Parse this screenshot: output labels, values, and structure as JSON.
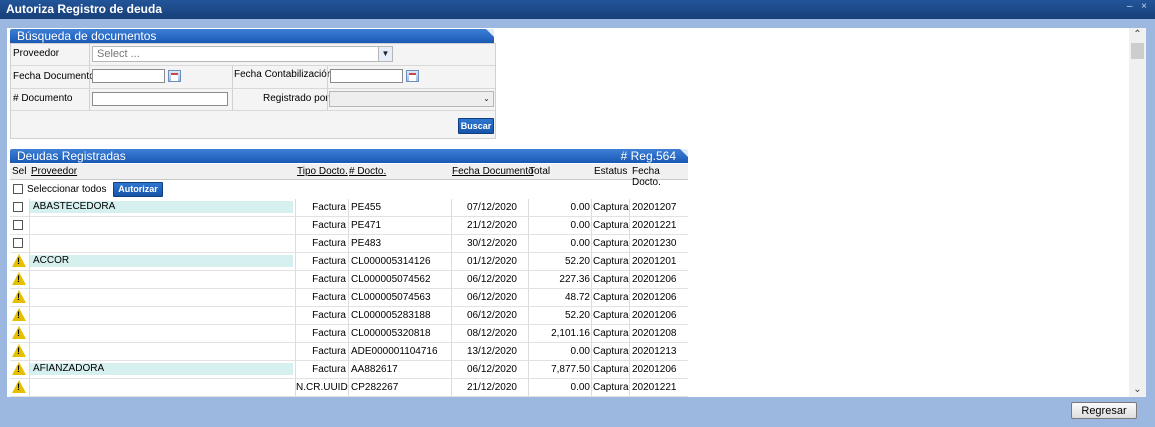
{
  "window": {
    "title": "Autoriza Registro de deuda",
    "minimize": "–",
    "close": "×"
  },
  "search": {
    "header": "Búsqueda de documentos",
    "proveedor_label": "Proveedor",
    "proveedor_placeholder": "Select ...",
    "fecha_documento_label": "Fecha Documento",
    "fecha_contabilizacion_label": "Fecha Contabilización",
    "num_documento_label": "# Documento",
    "registrado_por_label": "Registrado por",
    "buscar_label": "Buscar"
  },
  "grid": {
    "header": "Deudas Registradas",
    "reg_count": "# Reg.564",
    "columns": {
      "sel": "Sel",
      "proveedor": "Proveedor",
      "tipo": "Tipo Docto.",
      "num": "# Docto.",
      "fecha": "Fecha Documento",
      "total": "Total",
      "estatus": "Estatus",
      "fecha2": "Fecha Docto."
    },
    "select_all_label": "Seleccionar todos",
    "autorizar_label": "Autorizar",
    "rows": [
      {
        "icon": "checkbox",
        "proveedor": "ABASTECEDORA",
        "tipo": "Factura",
        "num": "PE455",
        "fecha": "07/12/2020",
        "total": "0.00",
        "estatus": "Captura",
        "fecha2": "20201207"
      },
      {
        "icon": "checkbox",
        "proveedor": "",
        "tipo": "Factura",
        "num": "PE471",
        "fecha": "21/12/2020",
        "total": "0.00",
        "estatus": "Captura",
        "fecha2": "20201221"
      },
      {
        "icon": "checkbox",
        "proveedor": "",
        "tipo": "Factura",
        "num": "PE483",
        "fecha": "30/12/2020",
        "total": "0.00",
        "estatus": "Captura",
        "fecha2": "20201230"
      },
      {
        "icon": "warning",
        "proveedor": "ACCOR",
        "tipo": "Factura",
        "num": "CL000005314126",
        "fecha": "01/12/2020",
        "total": "52.20",
        "estatus": "Captura",
        "fecha2": "20201201"
      },
      {
        "icon": "warning",
        "proveedor": "",
        "tipo": "Factura",
        "num": "CL000005074562",
        "fecha": "06/12/2020",
        "total": "227.36",
        "estatus": "Captura",
        "fecha2": "20201206"
      },
      {
        "icon": "warning",
        "proveedor": "",
        "tipo": "Factura",
        "num": "CL000005074563",
        "fecha": "06/12/2020",
        "total": "48.72",
        "estatus": "Captura",
        "fecha2": "20201206"
      },
      {
        "icon": "warning",
        "proveedor": "",
        "tipo": "Factura",
        "num": "CL000005283188",
        "fecha": "06/12/2020",
        "total": "52.20",
        "estatus": "Captura",
        "fecha2": "20201206"
      },
      {
        "icon": "warning",
        "proveedor": "",
        "tipo": "Factura",
        "num": "CL000005320818",
        "fecha": "08/12/2020",
        "total": "2,101.16",
        "estatus": "Captura",
        "fecha2": "20201208"
      },
      {
        "icon": "warning",
        "proveedor": "",
        "tipo": "Factura",
        "num": "ADE000001104716",
        "fecha": "13/12/2020",
        "total": "0.00",
        "estatus": "Captura",
        "fecha2": "20201213"
      },
      {
        "icon": "warning",
        "proveedor": "AFIANZADORA",
        "tipo": "Factura",
        "num": "AA882617",
        "fecha": "06/12/2020",
        "total": "7,877.50",
        "estatus": "Captura",
        "fecha2": "20201206"
      },
      {
        "icon": "warning",
        "proveedor": "",
        "tipo": "N.CR.UUID",
        "num": "CP282267",
        "fecha": "21/12/2020",
        "total": "0.00",
        "estatus": "Captura",
        "fecha2": "20201221"
      }
    ]
  },
  "footer": {
    "regresar_label": "Regresar"
  }
}
